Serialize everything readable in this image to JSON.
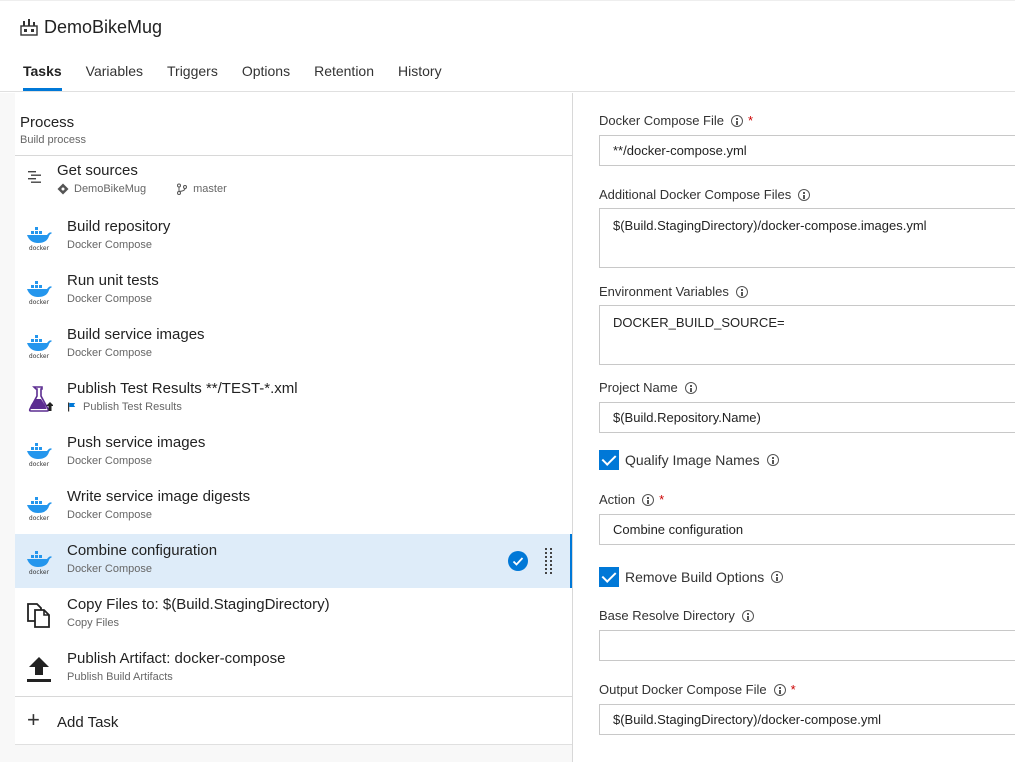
{
  "header": {
    "title": "DemoBikeMug",
    "tabs": [
      {
        "label": "Tasks",
        "active": true
      },
      {
        "label": "Variables"
      },
      {
        "label": "Triggers"
      },
      {
        "label": "Options"
      },
      {
        "label": "Retention"
      },
      {
        "label": "History"
      }
    ]
  },
  "process": {
    "title": "Process",
    "subtitle": "Build process"
  },
  "get_sources": {
    "name": "Get sources",
    "repo": "DemoBikeMug",
    "branch": "master"
  },
  "tasks": [
    {
      "name": "Build repository",
      "type": "Docker Compose",
      "icon": "docker-icon"
    },
    {
      "name": "Run unit tests",
      "type": "Docker Compose",
      "icon": "docker-icon"
    },
    {
      "name": "Build service images",
      "type": "Docker Compose",
      "icon": "docker-icon"
    },
    {
      "name": "Publish Test Results **/TEST-*.xml",
      "type": "Publish Test Results",
      "icon": "flask-icon"
    },
    {
      "name": "Push service images",
      "type": "Docker Compose",
      "icon": "docker-icon"
    },
    {
      "name": "Write service image digests",
      "type": "Docker Compose",
      "icon": "docker-icon"
    },
    {
      "name": "Combine configuration",
      "type": "Docker Compose",
      "icon": "docker-icon",
      "selected": true
    },
    {
      "name": "Copy Files to: $(Build.StagingDirectory)",
      "type": "Copy Files",
      "icon": "copy-files-icon"
    },
    {
      "name": "Publish Artifact: docker-compose",
      "type": "Publish Build Artifacts",
      "icon": "upload-icon"
    }
  ],
  "add_task": "Add Task",
  "docker_logo_text": "docker",
  "form": {
    "docker_compose_file": {
      "label": "Docker Compose File",
      "value": "**/docker-compose.yml"
    },
    "additional_files": {
      "label": "Additional Docker Compose Files",
      "value": "$(Build.StagingDirectory)/docker-compose.images.yml"
    },
    "env_vars": {
      "label": "Environment Variables",
      "value": "DOCKER_BUILD_SOURCE="
    },
    "project_name": {
      "label": "Project Name",
      "value": "$(Build.Repository.Name)"
    },
    "qualify_image_names": {
      "label": "Qualify Image Names",
      "checked": true
    },
    "action": {
      "label": "Action",
      "value": "Combine configuration"
    },
    "remove_build_options": {
      "label": "Remove Build Options",
      "checked": true
    },
    "base_resolve_dir": {
      "label": "Base Resolve Directory",
      "value": ""
    },
    "output_file": {
      "label": "Output Docker Compose File",
      "value": "$(Build.StagingDirectory)/docker-compose.yml"
    }
  },
  "colors": {
    "accent": "#0078d7",
    "selected_bg": "#deecf9",
    "required": "#cc0000"
  }
}
